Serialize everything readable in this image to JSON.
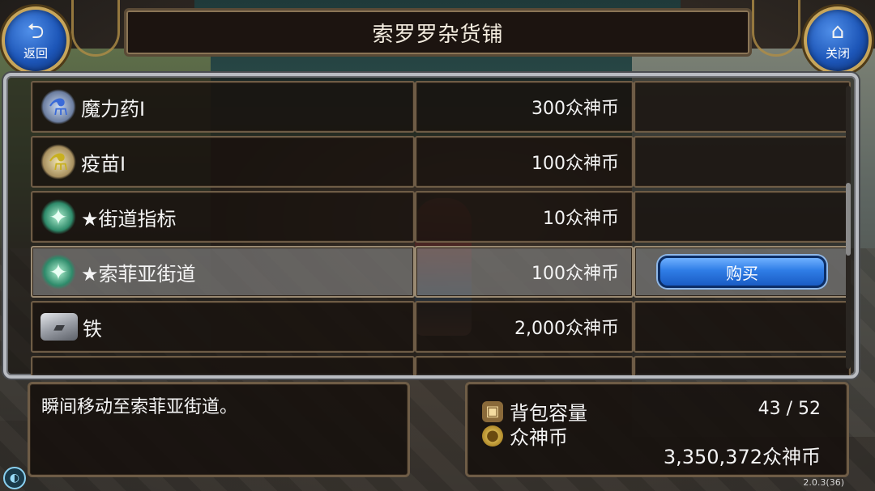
{
  "header": {
    "title": "索罗罗杂货铺",
    "back_label": "返回",
    "close_label": "关闭"
  },
  "items": [
    {
      "name": "魔力药Ⅰ",
      "price": "300众神币",
      "icon": "blue-potion-icon",
      "selected": false
    },
    {
      "name": "疫苗Ⅰ",
      "price": "100众神币",
      "icon": "yellow-potion-icon",
      "selected": false
    },
    {
      "name": "★街道指标",
      "price": "10众神币",
      "icon": "wing-scroll-icon",
      "selected": false
    },
    {
      "name": "★索菲亚街道",
      "price": "100众神币",
      "icon": "wing-scroll-icon",
      "selected": true
    },
    {
      "name": "铁",
      "price": "2,000众神币",
      "icon": "iron-ingot-icon",
      "selected": false
    }
  ],
  "buy_label": "购买",
  "description": "瞬间移动至索菲亚街道。",
  "inventory": {
    "bag_label": "背包容量",
    "bag_value": "43 / 52",
    "coin_label": "众神币",
    "coin_value": "3,350,372众神币"
  },
  "version": "2.0.3(36)",
  "colors": {
    "button_blue": "#2f7de6",
    "frame_gold": "#c7a55a",
    "panel_border": "#6e5c46"
  }
}
